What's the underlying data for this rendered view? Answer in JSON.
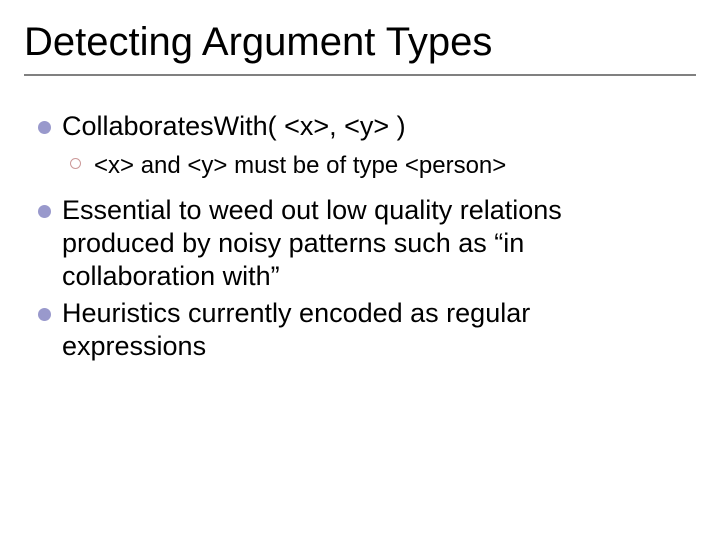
{
  "title": "Detecting Argument Types",
  "bullets": {
    "b1": "CollaboratesWith( <x>, <y> )",
    "b1_sub": "<x> and <y> must be of type <person>",
    "b2": "Essential to weed out low quality relations produced by noisy patterns such as “in collaboration with”",
    "b3": "Heuristics currently encoded as regular expressions"
  }
}
